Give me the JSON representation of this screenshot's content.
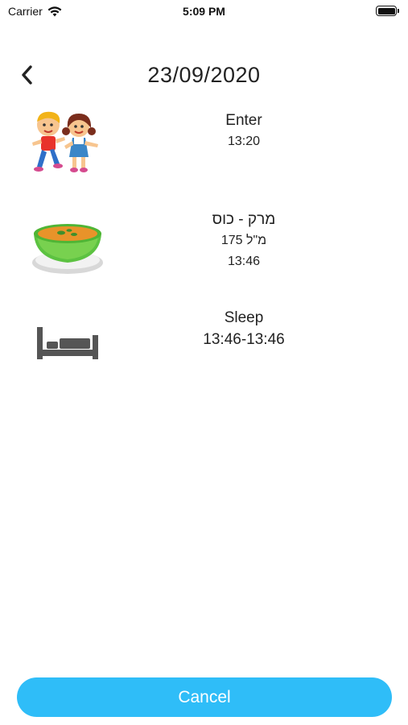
{
  "status_bar": {
    "carrier": "Carrier",
    "time": "5:09 PM"
  },
  "header": {
    "title": "23/09/2020",
    "back_icon": "chevron-left-icon"
  },
  "entries": [
    {
      "icon": "children-icon",
      "title": "Enter",
      "lines": [
        "13:20"
      ]
    },
    {
      "icon": "soup-bowl-icon",
      "title": "מרק - כוס",
      "lines": [
        "175 מ\"ל",
        "13:46"
      ]
    },
    {
      "icon": "bed-icon",
      "title": "Sleep",
      "lines": [
        "13:46-13:46"
      ]
    }
  ],
  "footer": {
    "cancel_label": "Cancel"
  },
  "colors": {
    "accent": "#2fbdf8",
    "text": "#222222",
    "background": "#ffffff"
  }
}
